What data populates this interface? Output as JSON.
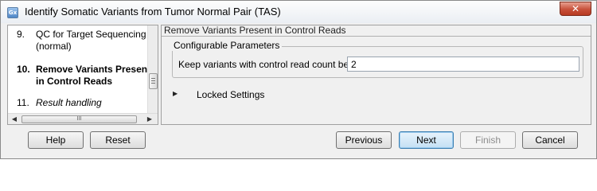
{
  "window": {
    "title": "Identify Somatic Variants from Tumor Normal Pair (TAS)",
    "app_icon_text": "Gx",
    "close_glyph": "✕"
  },
  "steps": [
    {
      "number": "9.",
      "label_line1": "QC for Target Sequencing",
      "label_line2": "(normal)",
      "state": "normal"
    },
    {
      "number": "10.",
      "label_line1": "Remove Variants Present",
      "label_line2": "in Control Reads",
      "state": "active"
    },
    {
      "number": "11.",
      "label_line1": "Result handling",
      "label_line2": "",
      "state": "italic"
    }
  ],
  "scrollbar": {
    "left_arrow": "◀",
    "right_arrow": "▶",
    "thumb_grip": "III"
  },
  "content": {
    "section_title": "Remove Variants Present in Control Reads",
    "group_title": "Configurable Parameters",
    "field_label": "Keep variants with control read count below",
    "field_value": "2",
    "locked_arrow": "▶",
    "locked_label": "Locked Settings"
  },
  "buttons": {
    "help": "Help",
    "reset": "Reset",
    "previous": "Previous",
    "next": "Next",
    "finish": "Finish",
    "cancel": "Cancel"
  }
}
